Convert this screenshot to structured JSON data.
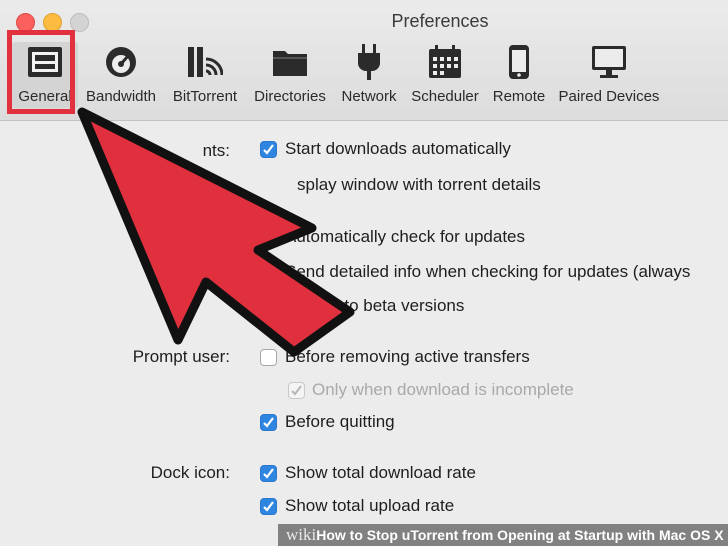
{
  "window": {
    "title": "Preferences"
  },
  "toolbar": {
    "items": [
      {
        "label": "General",
        "icon": "general-icon"
      },
      {
        "label": "Bandwidth",
        "icon": "gauge-icon"
      },
      {
        "label": "BitTorrent",
        "icon": "bittorrent-icon"
      },
      {
        "label": "Directories",
        "icon": "folder-icon"
      },
      {
        "label": "Network",
        "icon": "plug-icon"
      },
      {
        "label": "Scheduler",
        "icon": "calendar-icon"
      },
      {
        "label": "Remote",
        "icon": "phone-icon"
      },
      {
        "label": "Paired Devices",
        "icon": "monitor-icon"
      }
    ]
  },
  "sections": {
    "transfers_label": "nts:",
    "prompt_label": "Prompt user:",
    "dock_label": "Dock icon:"
  },
  "options": {
    "start_downloads": "Start downloads automatically",
    "display_window": "splay window with torrent details",
    "check_updates": "Automatically check for updates",
    "send_info": "Send detailed info when checking for updates (always",
    "beta": "ate to beta versions",
    "before_removing": "Before removing active transfers",
    "only_incomplete": "Only when download is incomplete",
    "before_quitting": "Before quitting",
    "show_download_rate": "Show total download rate",
    "show_upload_rate": "Show total upload rate"
  },
  "colors": {
    "highlight": "#e3303f",
    "arrow": "#e0303e",
    "checkbox": "#2f86e0"
  },
  "footer": {
    "wiki": "wiki",
    "how": "How",
    "rest": " to Stop uTorrent from Opening at Startup with Mac OS X"
  }
}
